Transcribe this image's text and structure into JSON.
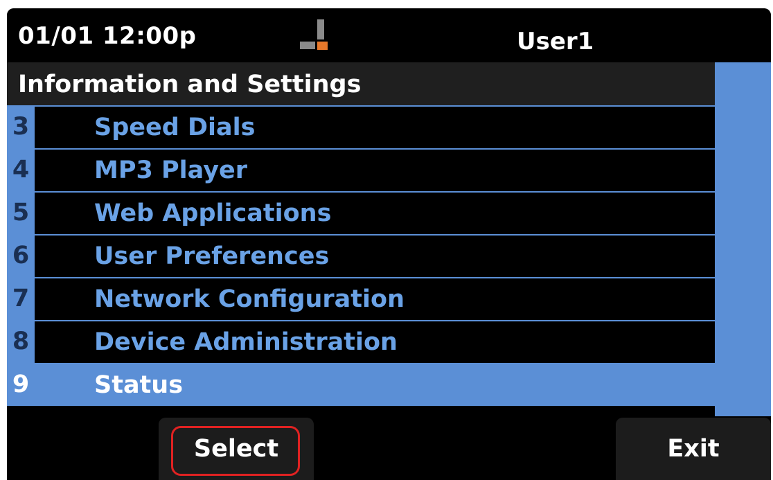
{
  "status_bar": {
    "datetime": "01/01 12:00p",
    "user": "User1",
    "line_icon": "line-status-icon",
    "colors": {
      "accent": "#e8782a",
      "icon_gray": "#8a8a8a"
    }
  },
  "menu": {
    "title": "Information and Settings",
    "items": [
      {
        "number": "3",
        "label": "Speed Dials",
        "selected": false
      },
      {
        "number": "4",
        "label": "MP3 Player",
        "selected": false
      },
      {
        "number": "5",
        "label": "Web Applications",
        "selected": false
      },
      {
        "number": "6",
        "label": "User Preferences",
        "selected": false
      },
      {
        "number": "7",
        "label": "Network Configuration",
        "selected": false
      },
      {
        "number": "8",
        "label": "Device Administration",
        "selected": false
      },
      {
        "number": "9",
        "label": "Status",
        "selected": true
      }
    ],
    "colors": {
      "highlight": "#5b8fd6",
      "item_text": "#6aa2e6"
    }
  },
  "softkeys": {
    "select_label": "Select",
    "exit_label": "Exit",
    "focus_color": "#e02222"
  }
}
